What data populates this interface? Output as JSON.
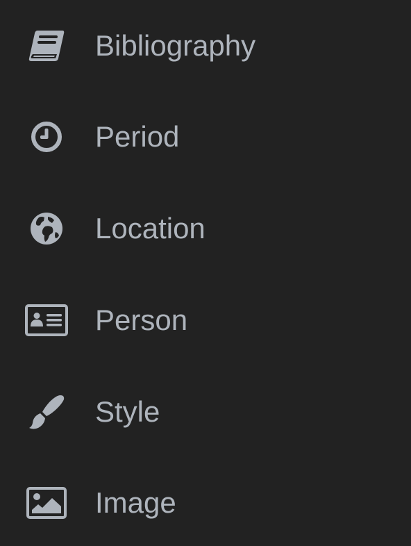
{
  "theme": {
    "background": "#222222",
    "foreground": "#aeb4bc"
  },
  "menu": {
    "items": [
      {
        "label": "Bibliography",
        "icon": "book-icon"
      },
      {
        "label": "Period",
        "icon": "clock-icon"
      },
      {
        "label": "Location",
        "icon": "globe-icon"
      },
      {
        "label": "Person",
        "icon": "id-card-icon"
      },
      {
        "label": "Style",
        "icon": "paintbrush-icon"
      },
      {
        "label": "Image",
        "icon": "image-icon"
      }
    ]
  }
}
